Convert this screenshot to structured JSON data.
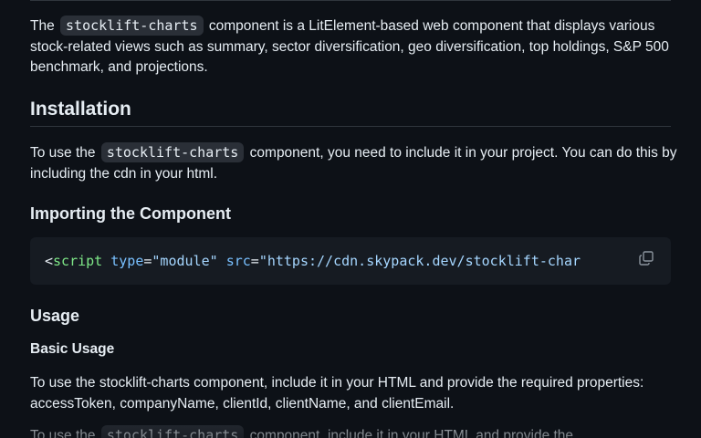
{
  "intro": {
    "before": "The",
    "code": "stocklift-charts",
    "after": "component is a LitElement-based web component that displays various stock-related views such as summary, sector diversification, geo diversification, top holdings, S&P 500 benchmark, and projections."
  },
  "installation": {
    "heading": "Installation",
    "para_before": "To use the",
    "para_code": "stocklift-charts",
    "para_after": "component, you need to include it in your project. You can do this by including the cdn in your html."
  },
  "importing": {
    "heading": "Importing the Component",
    "code": {
      "lt": "<",
      "tag": "script",
      "attr1": "type",
      "eq1": "=",
      "val1": "\"module\"",
      "attr2": "src",
      "eq2": "=",
      "val2": "\"https://cdn.skypack.dev/stocklift-char"
    },
    "copy_icon": "copy-icon"
  },
  "usage": {
    "heading": "Usage",
    "basic_heading": "Basic Usage",
    "para1": "To use the stocklift-charts component, include it in your HTML and provide the required properties: accessToken, companyName, clientId, clientName, and clientEmail.",
    "para2_before": "To use the",
    "para2_code": "stocklift-charts",
    "para2_after": "component, include it in your HTML and provide the"
  }
}
